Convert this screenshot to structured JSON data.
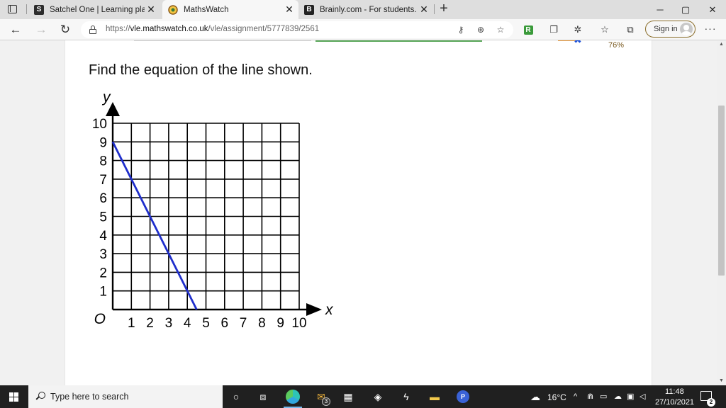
{
  "browser": {
    "tabs": [
      {
        "title": "Satchel One | Learning platform",
        "favicon": "S",
        "active": false
      },
      {
        "title": "MathsWatch",
        "favicon": "mathswatch-logo",
        "active": true
      },
      {
        "title": "Brainly.com - For students. By stu",
        "favicon": "B",
        "active": false
      }
    ],
    "new_tab_label": "+",
    "window_controls": {
      "minimize": "─",
      "maximize": "▢",
      "close": "✕"
    },
    "address": {
      "scheme": "https://",
      "host": "vle.mathswatch.co.uk",
      "path": "/vle/assignment/5777839/2561"
    },
    "extension_r": "R",
    "sign_in_label": "Sign in",
    "more_label": "···"
  },
  "page": {
    "score_percent": "76%",
    "question_text": "Find the equation of the line shown."
  },
  "chart_data": {
    "type": "line",
    "title": "",
    "xlabel": "x",
    "ylabel": "y",
    "origin_label": "O",
    "xlim": [
      0,
      10
    ],
    "ylim": [
      0,
      10
    ],
    "x_ticks": [
      1,
      2,
      3,
      4,
      5,
      6,
      7,
      8,
      9,
      10
    ],
    "y_ticks": [
      1,
      2,
      3,
      4,
      5,
      6,
      7,
      8,
      9,
      10
    ],
    "grid": true,
    "series": [
      {
        "x": [
          0,
          4.5
        ],
        "y": [
          9,
          0
        ],
        "color": "#1f2ecc"
      }
    ]
  },
  "taskbar": {
    "search_placeholder": "Type here to search",
    "mail_badge": "3",
    "temperature": "16°C",
    "time": "11:48",
    "date": "27/10/2021",
    "notification_count": "2"
  }
}
